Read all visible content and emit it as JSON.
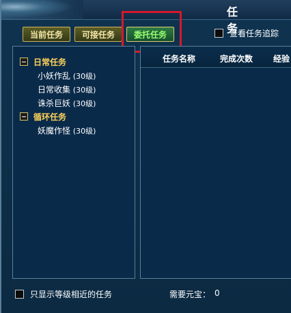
{
  "window": {
    "title": "任 务"
  },
  "tabs": [
    {
      "label": "当前任务",
      "active": false
    },
    {
      "label": "可接任务",
      "active": false
    },
    {
      "label": "委托任务",
      "active": true
    }
  ],
  "options": {
    "track_label": "查看任务追踪",
    "show_near_level_label": "只显示等级相近的任务"
  },
  "left_tree": {
    "categories": [
      {
        "label": "日常任务",
        "tasks": [
          {
            "name": "小妖作乱",
            "level": "(30级)"
          },
          {
            "name": "日常收集",
            "level": "(30级)"
          },
          {
            "name": "诛杀巨妖",
            "level": "(30级)"
          }
        ]
      },
      {
        "label": "循环任务",
        "tasks": [
          {
            "name": "妖魔作怪",
            "level": "(30级)"
          }
        ]
      }
    ]
  },
  "table": {
    "headers": [
      "任务名称",
      "完成次数",
      "经验"
    ]
  },
  "footer": {
    "need_label": "需要元宝：",
    "need_value": "0"
  },
  "colors": {
    "accent_gold": "#ffd35a",
    "active_tab_text": "#9cff6f",
    "highlight_red": "#d7182a"
  }
}
